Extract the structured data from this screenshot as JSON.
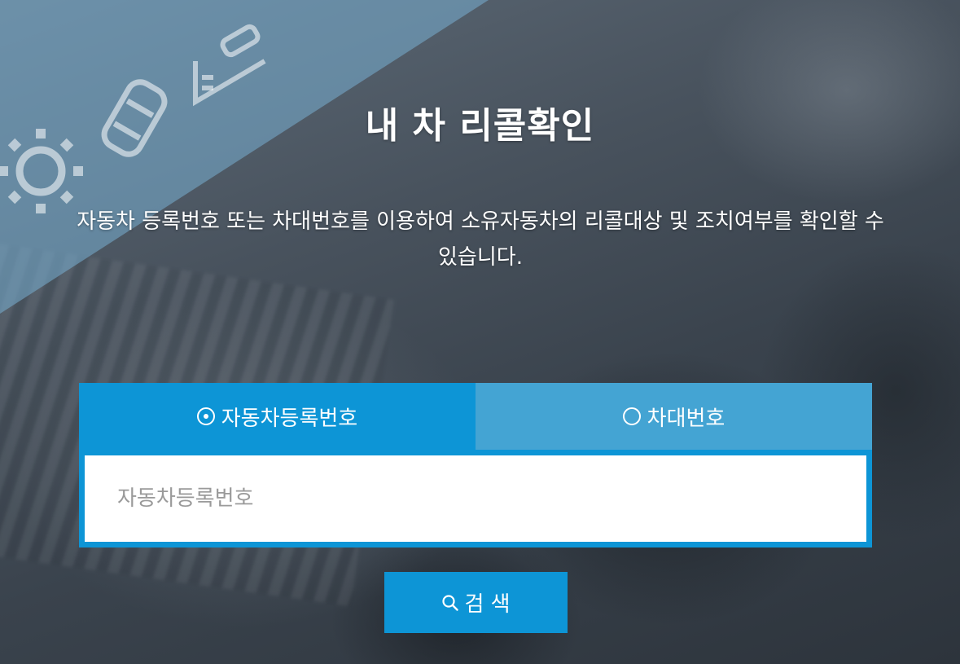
{
  "page": {
    "title": "내 차 리콜확인",
    "description": "자동차 등록번호 또는 차대번호를 이용하여 소유자동차의 리콜대상 및 조치여부를 확인할 수 있습니다."
  },
  "tabs": [
    {
      "label": "자동차등록번호",
      "selected": true
    },
    {
      "label": "차대번호",
      "selected": false
    }
  ],
  "search": {
    "value": "",
    "placeholder": "자동차등록번호",
    "button_label": "검 색"
  },
  "decorative_icons": [
    "gear-icon",
    "car-icon",
    "car-ramp-icon"
  ],
  "colors": {
    "active_tab": "#0d95d6",
    "inactive_tab": "#44a4d3",
    "button": "#0d95d6"
  }
}
